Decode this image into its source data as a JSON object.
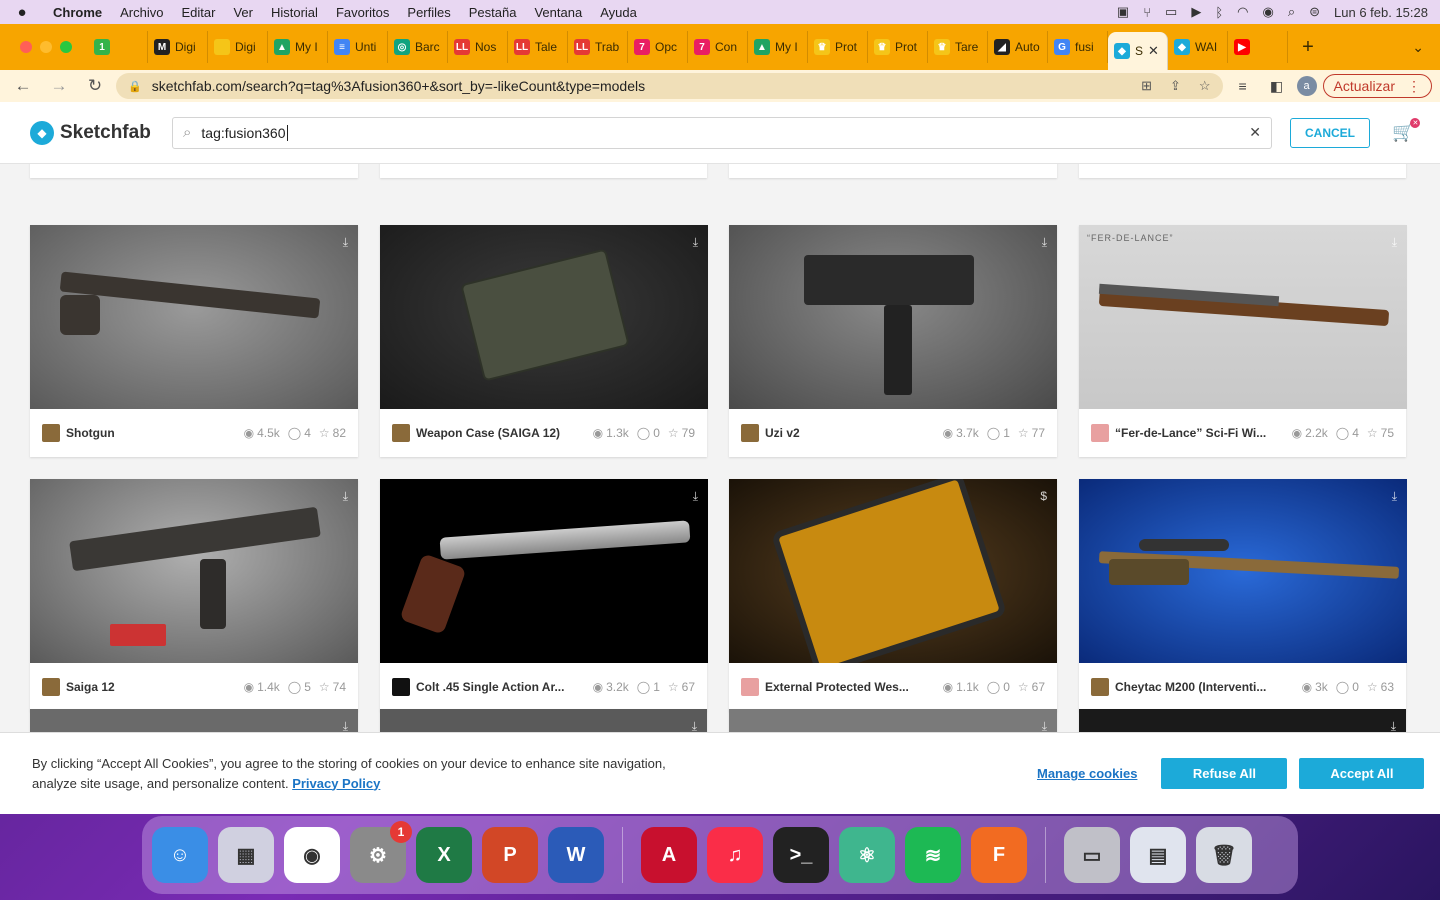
{
  "menubar": {
    "app": "Chrome",
    "items": [
      "Archivo",
      "Editar",
      "Ver",
      "Historial",
      "Favoritos",
      "Perfiles",
      "Pestaña",
      "Ventana",
      "Ayuda"
    ],
    "clock": "Lun 6 feb.  15:28"
  },
  "tabs": [
    {
      "label": "",
      "color": "#34b34a",
      "glyph": "1"
    },
    {
      "label": "Digi",
      "color": "#222222",
      "glyph": "M"
    },
    {
      "label": "Digi",
      "color": "#f5c518",
      "glyph": ""
    },
    {
      "label": "My I",
      "color": "#1fa463",
      "glyph": "▲"
    },
    {
      "label": "Unti",
      "color": "#4285f4",
      "glyph": "≡"
    },
    {
      "label": "Barc",
      "color": "#10a37f",
      "glyph": "◎"
    },
    {
      "label": "Nos",
      "color": "#e53935",
      "glyph": "LL"
    },
    {
      "label": "Tale",
      "color": "#e53935",
      "glyph": "LL"
    },
    {
      "label": "Trab",
      "color": "#e53935",
      "glyph": "LL"
    },
    {
      "label": "Opc",
      "color": "#e91e63",
      "glyph": "7"
    },
    {
      "label": "Con",
      "color": "#e91e63",
      "glyph": "7"
    },
    {
      "label": "My I",
      "color": "#1fa463",
      "glyph": "▲"
    },
    {
      "label": "Prot",
      "color": "#f5c518",
      "glyph": "♛"
    },
    {
      "label": "Prot",
      "color": "#f5c518",
      "glyph": "♛"
    },
    {
      "label": "Tare",
      "color": "#f5c518",
      "glyph": "♛"
    },
    {
      "label": "Auto",
      "color": "#222222",
      "glyph": "◢"
    },
    {
      "label": "fusi",
      "color": "#4285f4",
      "glyph": "G"
    },
    {
      "label": "S",
      "color": "#1caad9",
      "glyph": "◆",
      "active": true
    },
    {
      "label": "WAI",
      "color": "#1caad9",
      "glyph": "◆"
    },
    {
      "label": "",
      "color": "#ff0000",
      "glyph": "▶"
    }
  ],
  "toolbar": {
    "url": "sketchfab.com/search?q=tag%3Afusion360+&sort_by=-likeCount&type=models",
    "update_label": "Actualizar",
    "avatar_letter": "a"
  },
  "sketchfab": {
    "logo": "Sketchfab",
    "search_value": "tag:fusion360",
    "cancel_label": "CANCEL"
  },
  "models": [
    {
      "title": "Shotgun",
      "views": "4.5k",
      "comments": "4",
      "likes": "82",
      "avatar": "#8a6a3a",
      "bg": "radial-gradient(ellipse at 50% 45%, #9a9a9a 0%, #5a5a5a 100%)",
      "paid": false
    },
    {
      "title": "Weapon Case (SAIGA 12)",
      "views": "1.3k",
      "comments": "0",
      "likes": "79",
      "avatar": "#8a6a3a",
      "bg": "radial-gradient(ellipse at 50% 45%, #3a3a3a 0%, #1a1a1a 100%)",
      "paid": false
    },
    {
      "title": "Uzi v2",
      "views": "3.7k",
      "comments": "1",
      "likes": "77",
      "avatar": "#8a6a3a",
      "bg": "radial-gradient(ellipse at 50% 40%, #8a8a8a 0%, #4a4a4a 100%)",
      "paid": false
    },
    {
      "title": "“Fer-de-Lance” Sci-Fi Wi...",
      "views": "2.2k",
      "comments": "4",
      "likes": "75",
      "avatar": "#e8a0a0",
      "bg": "linear-gradient(180deg, #d8d8d8 0%, #c8c8c8 100%)",
      "paid": false,
      "caption": "“FER-DE-LANCE”"
    },
    {
      "title": "Saiga 12",
      "views": "1.4k",
      "comments": "5",
      "likes": "74",
      "avatar": "#8a6a3a",
      "bg": "radial-gradient(ellipse at 50% 40%, #b0b0b0 0%, #5a5a5a 100%)",
      "paid": false
    },
    {
      "title": "Colt .45 Single Action Ar...",
      "views": "3.2k",
      "comments": "1",
      "likes": "67",
      "avatar": "#111111",
      "bg": "#000000",
      "paid": false
    },
    {
      "title": "External Protected Wes...",
      "views": "1.1k",
      "comments": "0",
      "likes": "67",
      "avatar": "#e8a0a0",
      "bg": "radial-gradient(ellipse at 50% 50%, #5a4020 0%, #1a1208 100%)",
      "paid": true
    },
    {
      "title": "Cheytac M200 (Interventi...",
      "views": "3k",
      "comments": "0",
      "likes": "63",
      "avatar": "#8a6a3a",
      "bg": "radial-gradient(ellipse at 50% 50%, #2a6ad8 0%, #0a2a7a 100%)",
      "paid": false
    }
  ],
  "cookie": {
    "message": "By clicking “Accept All Cookies”, you agree to the storing of cookies on your device to enhance site navigation, analyze site usage, and personalize content.",
    "privacy": "Privacy Policy",
    "manage": "Manage cookies",
    "refuse": "Refuse All",
    "accept": "Accept All"
  },
  "dock": [
    {
      "name": "finder",
      "color": "#3a8ee6",
      "glyph": "☺"
    },
    {
      "name": "launchpad",
      "color": "#d0d0e0",
      "glyph": "▦"
    },
    {
      "name": "chrome",
      "color": "#ffffff",
      "glyph": "◉"
    },
    {
      "name": "system-preferences",
      "color": "#8a8a8a",
      "glyph": "⚙",
      "badge": "1"
    },
    {
      "name": "excel",
      "color": "#1f7a45",
      "glyph": "X"
    },
    {
      "name": "powerpoint",
      "color": "#d24726",
      "glyph": "P"
    },
    {
      "name": "word",
      "color": "#2b5bb8",
      "glyph": "W"
    },
    {
      "name": "acrobat",
      "color": "#c8102e",
      "glyph": "A"
    },
    {
      "name": "music",
      "color": "#fa2d48",
      "glyph": "♫"
    },
    {
      "name": "terminal",
      "color": "#222222",
      "glyph": ">_"
    },
    {
      "name": "atom",
      "color": "#3fb68e",
      "glyph": "⚛"
    },
    {
      "name": "spotify",
      "color": "#1db954",
      "glyph": "≋"
    },
    {
      "name": "fusion360",
      "color": "#f26b21",
      "glyph": "F"
    },
    {
      "name": "disk-utility",
      "color": "#c0c0c8",
      "glyph": "▭"
    },
    {
      "name": "screenshot-preview",
      "color": "#e0e4ee",
      "glyph": "▤"
    },
    {
      "name": "trash",
      "color": "#d8dce4",
      "glyph": "🗑"
    }
  ]
}
